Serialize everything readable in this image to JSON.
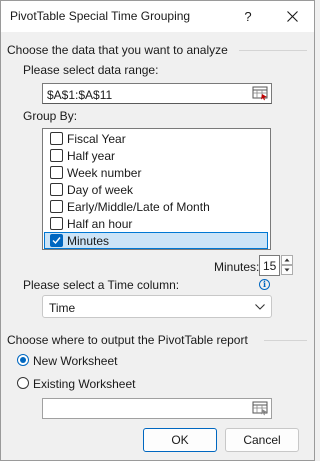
{
  "window": {
    "title": "PivotTable Special Time Grouping",
    "help_glyph": "?",
    "close_icon": "close-icon"
  },
  "data_section": {
    "heading": "Choose the data that you want to analyze",
    "range_label": "Please select data range:",
    "range_value": "$A$1:$A$11",
    "range_button_icon": "range-select-icon"
  },
  "group_by": {
    "label": "Group By:",
    "items": [
      {
        "label": "Fiscal Year",
        "checked": false,
        "selected": false
      },
      {
        "label": "Half year",
        "checked": false,
        "selected": false
      },
      {
        "label": "Week number",
        "checked": false,
        "selected": false
      },
      {
        "label": "Day of week",
        "checked": false,
        "selected": false
      },
      {
        "label": "Early/Middle/Late of Month",
        "checked": false,
        "selected": false
      },
      {
        "label": "Half an hour",
        "checked": false,
        "selected": false
      },
      {
        "label": "Minutes",
        "checked": true,
        "selected": true
      }
    ]
  },
  "minutes": {
    "label": "Minutes:",
    "value": "15"
  },
  "time_column": {
    "label": "Please select a Time column:",
    "value": "Time",
    "info_glyph": "i"
  },
  "output_section": {
    "heading": "Choose where to output the PivotTable report",
    "new_worksheet_label": "New Worksheet",
    "existing_worksheet_label": "Existing Worksheet",
    "selected": "new_worksheet",
    "existing_value": ""
  },
  "buttons": {
    "ok": "OK",
    "cancel": "Cancel"
  },
  "colors": {
    "accent": "#0067c0",
    "selection_bg": "#cce4f7",
    "dialog_bg": "#f0f0f0"
  }
}
